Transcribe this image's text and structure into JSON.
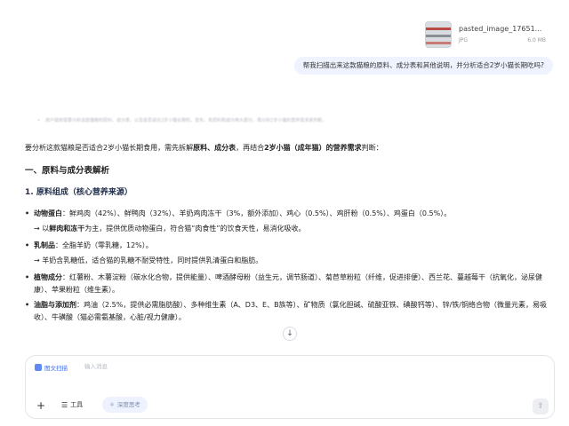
{
  "attachment": {
    "name": "pasted_image_17651...",
    "type": "JPG",
    "size": "6.0 MB"
  },
  "user_message": "帮我扫描出来这款猫粮的原料、成分表和其他说明，并分析适合2岁小猫长期吃吗?",
  "thinking_text": "用户提到需要分析这款猫粮的原料、成分表，以及是否适合2岁小猫长期吃。首先，有原料和成分两大部分，再分析2岁小猫的营养需求来判断。",
  "answer": {
    "intro_pre": "要分析这款猫粮是否适合2岁小猫长期食用，需先拆解",
    "intro_b1": "原料、成分表",
    "intro_mid": "，再结合",
    "intro_b2": "2岁小猫（成年猫）的营养需求",
    "intro_post": "判断：",
    "h1": "一、原料与成分表解析",
    "h2": "1. 原料组成（核心营养来源）",
    "items": [
      {
        "key": "动物蛋白",
        "text": "：鲜鸡肉（42%）、鲜鸭肉（32%）、羊奶鸡肉冻干（3%，额外添加）、鸡心（0.5%）、鸡肝粉（0.5%）、鸡蛋白（0.5%）。",
        "note_pre": "→ 以",
        "note_b": "鲜肉和冻干",
        "note_post": "为主，提供优质动物蛋白，符合猫“肉食性”的饮食天性，易消化吸收。"
      },
      {
        "key": "乳制品",
        "text": "：全脂羊奶（零乳糖，12%）。",
        "note_pre": "→ 羊奶含乳糖低，适合猫的乳糖不耐受特性，同时提供乳清蛋白和脂肪。",
        "note_b": "",
        "note_post": ""
      },
      {
        "key": "植物成分",
        "text": "：红薯粉、木薯淀粉（碳水化合物，提供能量）、啤酒酵母粉（益生元，调节肠道）、菊苣草粉粒（纤维，促进排便）、西兰花、蔓越莓干（抗氧化，泌尿健康）、苹果粉粒（维生素）。",
        "note_pre": "",
        "note_b": "",
        "note_post": ""
      },
      {
        "key": "油脂与添加剂",
        "text": "：鸡油（2.5%，提供必需脂肪酸）、多种维生素（A、D3、E、B族等）、矿物质（氯化胆碱、硫酸亚铁、碘酸钙等）、锌/铁/铜络合物（微量元素，易吸收）、牛磺酸（猫必需氨基酸，心脏/视力健康）。",
        "note_pre": "",
        "note_b": "",
        "note_post": ""
      }
    ]
  },
  "composer": {
    "mode_label": "图文扫描",
    "placeholder": "输入消息",
    "tools_label": "工具",
    "think_label": "深度思考"
  },
  "colors": {
    "accent": "#3a6cf0",
    "user_bubble": "#eef3ff"
  }
}
